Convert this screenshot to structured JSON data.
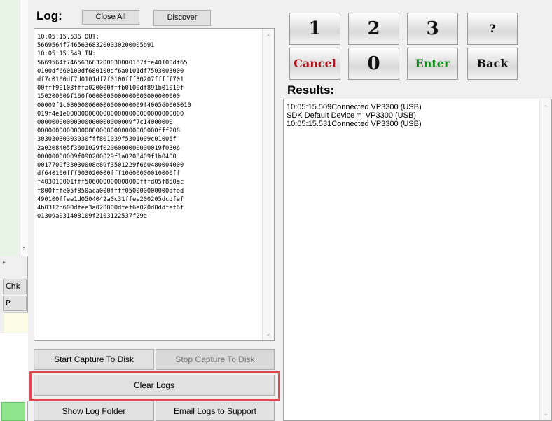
{
  "left_strip": {
    "btn_chk": "Chk",
    "btn_p": "P"
  },
  "log": {
    "title": "Log:",
    "close_all": "Close All",
    "discover": "Discover",
    "lines": [
      "10:05:15.536 OUT:",
      "5669564f746563683200030200005b91",
      "10:05:15.549 IN:",
      "5669564f746563683200030000167ffe40100df65",
      "0100df660100df680100df6a0101df7503003000",
      "df7c0100df7d0101df7f0100fff30207fffff701",
      "00fff90103fffa020000fffb0100df891b01019f",
      "150200009f160f0000000000000000000000000",
      "00009f1c080000000000000000009f400560000010",
      "019f4e1e00000000000000000000000000000000",
      "00000000000000000000000009f7c14000000",
      "000000000000000000000000000000000fff208",
      "30303030303030fff801039f5301009c01005f",
      "2a0208405f3601029f0206000000000019f0306",
      "00000000009f090200029f1a0208409f1b0400",
      "0017709f33030008e89f3501229f660480004000",
      "df640100fff003020000fff10600000010000ff",
      "f403010001fff506000000008000fffd05f850ac",
      "f800fffe05f850aca000ffff050000000000dfed",
      "490100ffee1d0504042a0c31ffee200205dcdfef",
      "4b0312b600dfee3a020000dfef6e020d0ddfef6f",
      "01309a031408109f2103122537f29e"
    ]
  },
  "buttons": {
    "start_capture": "Start Capture To Disk",
    "stop_capture": "Stop Capture To Disk",
    "clear_logs": "Clear Logs",
    "show_log_folder": "Show Log Folder",
    "email_logs": "Email Logs to Support"
  },
  "keypad": {
    "k1": "1",
    "k2": "2",
    "k3": "3",
    "kq": "?",
    "cancel": "Cancel",
    "k0": "0",
    "enter": "Enter",
    "back": "Back",
    "cancel_color": "#b01018",
    "enter_color": "#128a1a"
  },
  "results": {
    "title": "Results:",
    "lines": [
      "10:05:15.509Connected VP3300 (USB)",
      "SDK Default Device =  VP3300 (USB)",
      "10:05:15.531Connected VP3300 (USB)"
    ]
  },
  "highlight_color": "#e0484f"
}
